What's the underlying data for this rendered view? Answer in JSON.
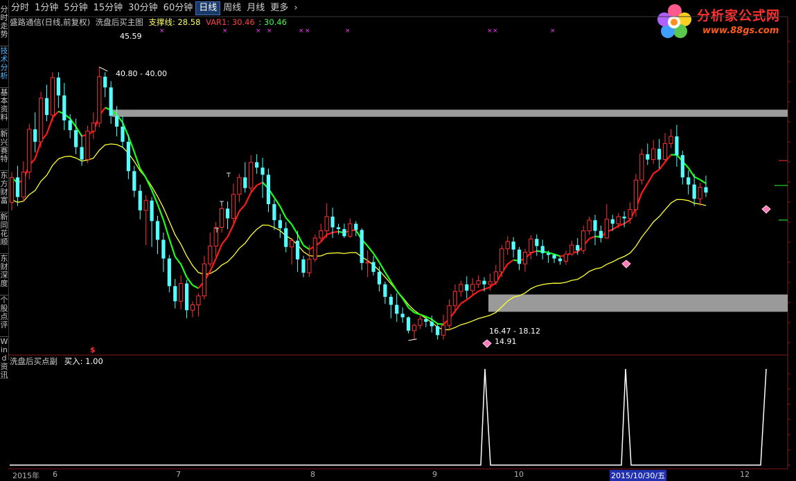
{
  "toolbar": {
    "tabs": [
      {
        "label": "分时"
      },
      {
        "label": "1分钟"
      },
      {
        "label": "5分钟"
      },
      {
        "label": "15分钟"
      },
      {
        "label": "30分钟"
      },
      {
        "label": "60分钟"
      },
      {
        "label": "日线"
      },
      {
        "label": "周线"
      },
      {
        "label": "月线"
      },
      {
        "label": "更多"
      }
    ],
    "active_tab": "日线",
    "more_icon": "chevron-right-icon"
  },
  "sidebar": {
    "items": [
      {
        "label": "分时走势"
      },
      {
        "label": "技术分析"
      },
      {
        "label": "基本资料"
      },
      {
        "label": "新兴赛特"
      },
      {
        "label": "东方财富"
      },
      {
        "label": "新同花顺"
      },
      {
        "label": "东财深度"
      },
      {
        "label": "个股点评"
      },
      {
        "label": "Wind资讯"
      }
    ],
    "active": "技术分析"
  },
  "main_info": {
    "stock": "盛路通信(日线,前复权)",
    "indicator": "洗盘后买主图",
    "support_label": "支撑线: 28.58",
    "var1_label": "VAR1: 30.46",
    "var1_value": ": 30.46"
  },
  "sub_info": {
    "indicator": "洗盘后买点副",
    "buy_label": "买入: 1.00"
  },
  "logo": {
    "title": "分析家公式网",
    "url": "www.88gs.com",
    "icon": "flower-logo-icon"
  },
  "annotations": {
    "high": "45.59",
    "resist": "40.80 - 40.00",
    "support": "16.47 - 18.12",
    "low": "14.91",
    "dollar": "$"
  },
  "date_axis": {
    "labels": [
      "2015年",
      "6",
      "7",
      "8",
      "9",
      "10",
      "2015/10/30/五",
      "12"
    ]
  },
  "colors": {
    "up": "#ff3232",
    "down": "#54ffff",
    "ma_up": "#ff1a1a",
    "ma_down": "#1aff1a",
    "support": "#ffff33",
    "band": "#9a9a9a",
    "mark": "#ff33ff",
    "signal": "#ffffff"
  },
  "chart_data": [
    {
      "type": "candlestick",
      "title": "盛路通信(日线,前复权) 洗盘后买主图",
      "ylim": [
        13.5,
        50
      ],
      "candles": [
        [
          30.4,
          33.2,
          29.5,
          33.8
        ],
        [
          33.2,
          31.0,
          30.0,
          34.5
        ],
        [
          31.0,
          33.8,
          30.5,
          35.0
        ],
        [
          33.8,
          38.6,
          33.0,
          39.2
        ],
        [
          38.6,
          37.2,
          36.0,
          40.5
        ],
        [
          37.2,
          42.1,
          36.5,
          42.8
        ],
        [
          42.1,
          40.2,
          39.5,
          43.6
        ],
        [
          40.2,
          44.4,
          39.5,
          45.0
        ],
        [
          44.4,
          42.4,
          41.0,
          45.0
        ],
        [
          42.4,
          39.6,
          38.5,
          43.8
        ],
        [
          39.6,
          38.5,
          37.6,
          40.3
        ],
        [
          38.5,
          36.6,
          35.8,
          39.8
        ],
        [
          36.6,
          35.2,
          34.5,
          38.0
        ],
        [
          35.2,
          38.4,
          34.8,
          39.0
        ],
        [
          38.4,
          39.3,
          37.5,
          40.5
        ],
        [
          39.3,
          44.5,
          38.8,
          45.6
        ],
        [
          44.5,
          43.3,
          42.2,
          45.0
        ],
        [
          43.3,
          40.1,
          39.2,
          44.0
        ],
        [
          40.1,
          38.9,
          37.8,
          41.2
        ],
        [
          38.9,
          37.2,
          36.5,
          40.1
        ],
        [
          37.2,
          33.9,
          33.0,
          38.0
        ],
        [
          33.9,
          31.7,
          31.0,
          34.5
        ],
        [
          31.7,
          29.5,
          28.5,
          32.4
        ],
        [
          29.5,
          30.6,
          25.6,
          31.2
        ],
        [
          30.6,
          28.3,
          25.4,
          31.0
        ],
        [
          28.3,
          26.2,
          24.6,
          28.9
        ],
        [
          26.2,
          24.1,
          22.6,
          27.0
        ],
        [
          24.1,
          21.0,
          20.3,
          24.5
        ],
        [
          21.0,
          19.3,
          18.5,
          21.8
        ],
        [
          19.3,
          21.3,
          18.4,
          22.2
        ],
        [
          21.3,
          18.3,
          17.4,
          21.7
        ],
        [
          18.3,
          18.9,
          17.5,
          19.3
        ],
        [
          18.9,
          19.9,
          17.6,
          20.2
        ],
        [
          19.9,
          23.5,
          19.5,
          24.4
        ],
        [
          23.5,
          25.5,
          23.2,
          27.0
        ],
        [
          25.5,
          27.6,
          24.3,
          28.2
        ],
        [
          27.6,
          29.7,
          27.0,
          30.3
        ],
        [
          29.7,
          28.6,
          27.4,
          30.5
        ],
        [
          28.6,
          31.3,
          28.1,
          32.5
        ],
        [
          31.3,
          33.2,
          30.4,
          33.6
        ],
        [
          33.2,
          32.0,
          31.5,
          34.9
        ],
        [
          32.0,
          34.9,
          31.6,
          35.7
        ],
        [
          34.9,
          34.3,
          33.6,
          35.8
        ],
        [
          34.3,
          33.5,
          30.9,
          35.4
        ],
        [
          33.5,
          30.2,
          29.3,
          34.2
        ],
        [
          30.2,
          28.4,
          27.3,
          30.7
        ],
        [
          28.4,
          27.5,
          26.4,
          29.1
        ],
        [
          27.5,
          25.4,
          24.8,
          28.2
        ],
        [
          25.4,
          26.1,
          23.4,
          26.4
        ],
        [
          26.1,
          24.0,
          22.6,
          27.2
        ],
        [
          24.0,
          22.5,
          22.0,
          24.4
        ],
        [
          22.5,
          24.0,
          22.0,
          25.6
        ],
        [
          24.0,
          26.4,
          23.7,
          26.8
        ],
        [
          26.4,
          27.2,
          26.0,
          28.0
        ],
        [
          27.2,
          28.8,
          26.4,
          30.3
        ],
        [
          28.8,
          27.6,
          26.4,
          29.8
        ],
        [
          27.6,
          27.4,
          26.8,
          28.0
        ],
        [
          27.4,
          26.6,
          26.4,
          28.0
        ],
        [
          26.6,
          28.0,
          26.4,
          28.6
        ],
        [
          28.0,
          27.3,
          26.6,
          28.3
        ],
        [
          27.3,
          23.6,
          22.8,
          27.5
        ],
        [
          23.6,
          23.7,
          22.0,
          25.0
        ],
        [
          23.7,
          22.6,
          22.2,
          24.4
        ],
        [
          22.6,
          21.2,
          20.4,
          23.2
        ],
        [
          21.2,
          19.8,
          19.0,
          21.5
        ],
        [
          19.8,
          18.9,
          17.4,
          20.1
        ],
        [
          18.9,
          17.9,
          17.0,
          20.2
        ],
        [
          17.9,
          17.5,
          16.9,
          18.6
        ],
        [
          17.5,
          16.0,
          15.7,
          17.6
        ],
        [
          16.0,
          16.6,
          15.0,
          16.8
        ],
        [
          16.6,
          17.3,
          16.2,
          17.8
        ],
        [
          17.3,
          17.0,
          16.4,
          17.5
        ],
        [
          17.0,
          16.5,
          15.8,
          17.7
        ],
        [
          16.5,
          15.5,
          15.0,
          16.8
        ],
        [
          15.5,
          16.6,
          15.0,
          17.8
        ],
        [
          16.6,
          18.8,
          16.0,
          19.5
        ],
        [
          18.8,
          20.4,
          18.0,
          21.2
        ],
        [
          20.4,
          21.2,
          19.8,
          21.6
        ],
        [
          21.2,
          20.5,
          19.6,
          22.1
        ],
        [
          20.5,
          21.2,
          20.0,
          21.9
        ],
        [
          21.2,
          21.6,
          20.8,
          22.2
        ],
        [
          21.6,
          21.2,
          20.4,
          22.0
        ],
        [
          21.2,
          21.5,
          20.5,
          22.4
        ],
        [
          21.5,
          22.6,
          21.1,
          23.4
        ],
        [
          22.6,
          25.2,
          22.0,
          25.6
        ],
        [
          25.2,
          26.0,
          24.5,
          26.6
        ],
        [
          26.0,
          25.1,
          24.2,
          26.5
        ],
        [
          25.1,
          23.5,
          22.8,
          25.4
        ],
        [
          23.5,
          24.8,
          22.6,
          25.2
        ],
        [
          24.8,
          26.3,
          24.0,
          26.7
        ],
        [
          26.3,
          25.5,
          24.4,
          26.8
        ],
        [
          25.5,
          24.7,
          24.0,
          26.2
        ],
        [
          24.7,
          24.5,
          23.6,
          25.0
        ],
        [
          24.5,
          24.1,
          23.6,
          24.6
        ],
        [
          24.1,
          23.8,
          23.4,
          24.3
        ],
        [
          23.8,
          24.6,
          23.4,
          25.0
        ],
        [
          24.6,
          25.6,
          24.4,
          26.1
        ],
        [
          25.6,
          25.0,
          24.5,
          26.4
        ],
        [
          25.0,
          27.2,
          24.6,
          27.8
        ],
        [
          27.2,
          28.4,
          26.8,
          28.8
        ],
        [
          28.4,
          27.2,
          25.6,
          29.0
        ],
        [
          27.2,
          26.4,
          25.9,
          27.8
        ],
        [
          26.4,
          28.5,
          26.3,
          30.2
        ],
        [
          28.5,
          28.0,
          27.2,
          29.0
        ],
        [
          28.0,
          28.8,
          27.5,
          29.2
        ],
        [
          28.8,
          28.6,
          27.6,
          29.4
        ],
        [
          28.6,
          29.6,
          28.0,
          30.4
        ],
        [
          29.6,
          32.9,
          28.8,
          33.6
        ],
        [
          32.9,
          35.8,
          32.4,
          36.4
        ],
        [
          35.8,
          35.2,
          34.6,
          37.0
        ],
        [
          35.2,
          36.4,
          34.7,
          37.4
        ],
        [
          36.4,
          35.2,
          34.2,
          37.5
        ],
        [
          35.2,
          37.0,
          34.9,
          38.2
        ],
        [
          37.0,
          37.8,
          36.5,
          38.6
        ],
        [
          37.8,
          35.7,
          34.4,
          39.1
        ],
        [
          35.7,
          33.2,
          32.4,
          36.2
        ],
        [
          33.2,
          32.4,
          31.3,
          34.0
        ],
        [
          32.4,
          30.8,
          30.0,
          33.6
        ],
        [
          30.8,
          32.1,
          30.0,
          32.6
        ],
        [
          32.1,
          31.5,
          31.0,
          33.4
        ]
      ],
      "support_line": "yellow moving line",
      "trend_line": "red (rising) / green (falling) moving line",
      "levels": [
        {
          "label": "40.80 - 40.00",
          "low": 40.0,
          "high": 40.8
        },
        {
          "label": "16.47 - 18.12",
          "low": 16.47,
          "high": 18.12
        }
      ],
      "markers": {
        "high": 45.59,
        "low": 14.91
      }
    },
    {
      "type": "line",
      "title": "洗盘后买点副",
      "series": [
        {
          "name": "买入",
          "spikes_at_candle": [
            73,
            95,
            118
          ],
          "value": 1.0
        }
      ],
      "ylim": [
        0,
        1
      ]
    }
  ]
}
